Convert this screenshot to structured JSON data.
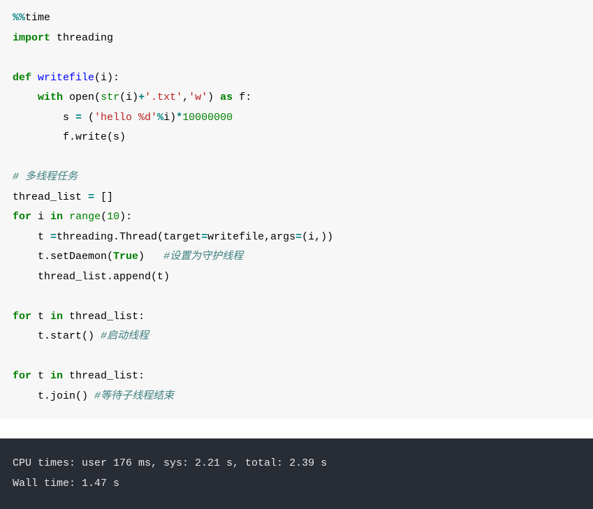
{
  "code": {
    "l1_magic_percent": "%%",
    "l1_time": "time",
    "l2_import": "import",
    "l2_threading": " threading",
    "l3_blank": "",
    "l4_def": "def",
    "l4_fname": " writefile",
    "l4_paren_i": "(i):",
    "l5_indent": "    ",
    "l5_with": "with",
    "l5_open": " open",
    "l5_p1": "(",
    "l5_str": "str",
    "l5_p2": "(i)",
    "l5_plus": "+",
    "l5_txt": "'.txt'",
    "l5_comma": ",",
    "l5_w": "'w'",
    "l5_p3": ") ",
    "l5_as": "as",
    "l5_f": " f:",
    "l6_indent": "        s ",
    "l6_eq": "=",
    "l6_sp": " (",
    "l6_hello": "'hello %d'",
    "l6_pct": "%",
    "l6_i": "i)",
    "l6_mul": "*",
    "l6_num": "10000000",
    "l7": "        f.write(s)",
    "l8_blank": "",
    "l9_comment": "# 多线程任务",
    "l10": "thread_list ",
    "l10_eq": "=",
    "l10_b": " []",
    "l11_for": "for",
    "l11_i": " i ",
    "l11_in": "in",
    "l11_sp": " ",
    "l11_range": "range",
    "l11_p": "(",
    "l11_num": "10",
    "l11_p2": "):",
    "l12_a": "    t ",
    "l12_eq": "=",
    "l12_b": "threading.Thread(target",
    "l12_eq2": "=",
    "l12_c": "writefile,args",
    "l12_eq3": "=",
    "l12_d": "(i,))",
    "l13_a": "    t.setDaemon(",
    "l13_true": "True",
    "l13_b": ")   ",
    "l13_comment": "#设置为守护线程",
    "l14": "    thread_list.append(t)",
    "l15_blank": "",
    "l16_for": "for",
    "l16_t": " t ",
    "l16_in": "in",
    "l16_rest": " thread_list:",
    "l17_a": "    t.start() ",
    "l17_comment": "#启动线程",
    "l18_blank": "",
    "l19_for": "for",
    "l19_t": " t ",
    "l19_in": "in",
    "l19_rest": " thread_list:",
    "l20_a": "    t.join() ",
    "l20_comment": "#等待子线程结束"
  },
  "output": {
    "line1": "CPU times: user 176 ms, sys: 2.21 s, total: 2.39 s",
    "line2": "Wall time: 1.47 s"
  }
}
